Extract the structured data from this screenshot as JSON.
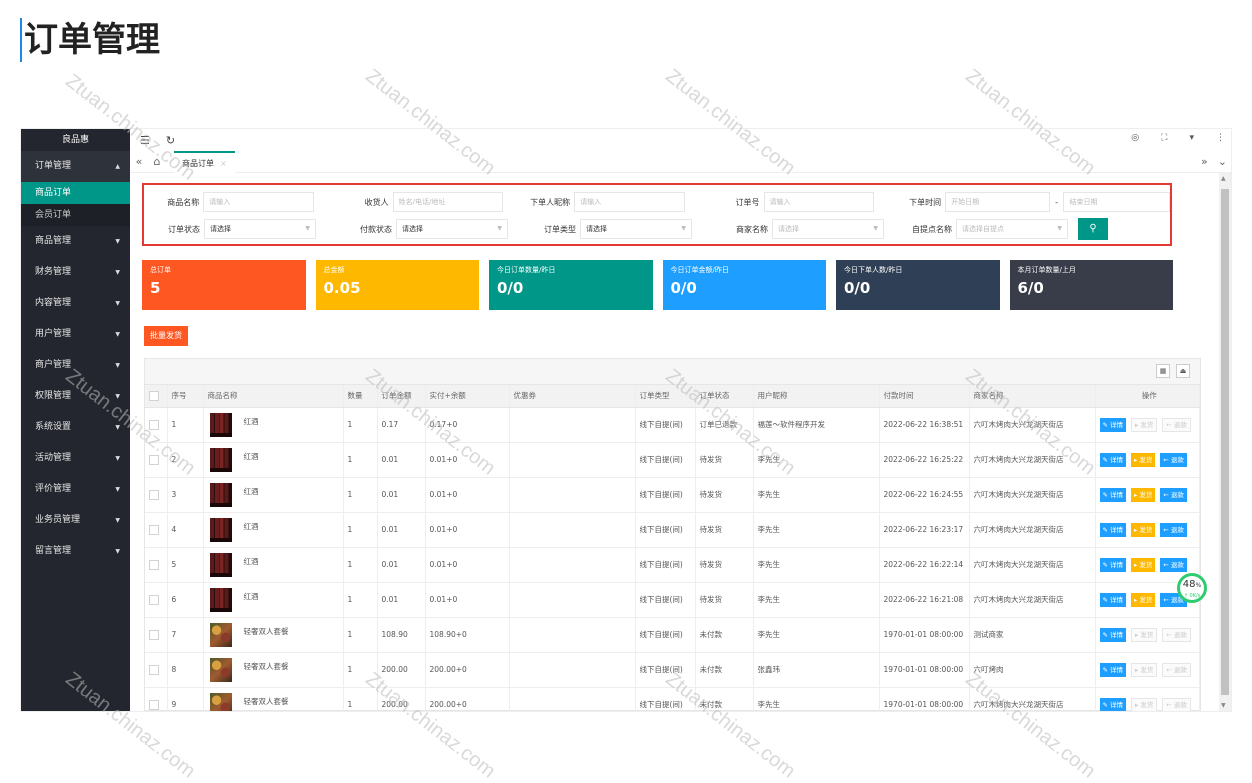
{
  "page_title": "订单管理",
  "watermark": "Ztuan.chinaz.com",
  "sidebar": {
    "logo": "良品惠",
    "menu": [
      {
        "label": "订单管理",
        "open": true,
        "children": [
          {
            "label": "商品订单",
            "active": true
          },
          {
            "label": "会员订单",
            "active": false
          }
        ]
      },
      {
        "label": "商品管理"
      },
      {
        "label": "财务管理"
      },
      {
        "label": "内容管理"
      },
      {
        "label": "用户管理"
      },
      {
        "label": "商户管理"
      },
      {
        "label": "权限管理"
      },
      {
        "label": "系统设置"
      },
      {
        "label": "活动管理"
      },
      {
        "label": "评价管理"
      },
      {
        "label": "业务员管理"
      },
      {
        "label": "留言管理"
      }
    ]
  },
  "tabs": {
    "active_label": "商品订单",
    "close": "×"
  },
  "filters": {
    "product_name": {
      "label": "商品名称",
      "placeholder": "请输入"
    },
    "receiver": {
      "label": "收货人",
      "placeholder": "姓名/电话/地址"
    },
    "buyer_nick": {
      "label": "下单人昵称",
      "placeholder": "请输入"
    },
    "order_no": {
      "label": "订单号",
      "placeholder": "请输入"
    },
    "order_time": {
      "label": "下单时间",
      "start_placeholder": "开始日期",
      "sep": "-",
      "end_placeholder": "结束日期"
    },
    "order_status": {
      "label": "订单状态",
      "value": "请选择"
    },
    "pay_status": {
      "label": "付款状态",
      "value": "请选择"
    },
    "order_type": {
      "label": "订单类型",
      "value": "请选择"
    },
    "merchant": {
      "label": "商家名称",
      "placeholder": "请选择"
    },
    "pickup_point": {
      "label": "自提点名称",
      "placeholder": "请选择自提点"
    },
    "search_icon": "search-icon"
  },
  "cards": [
    {
      "title": "总订单",
      "value": "5",
      "color": "#ff5722"
    },
    {
      "title": "总金额",
      "value": "0.05",
      "color": "#ffb800"
    },
    {
      "title": "今日订单数量/昨日",
      "value": "0/0",
      "color": "#009688"
    },
    {
      "title": "今日订单金额/昨日",
      "value": "0/0",
      "color": "#1e9fff"
    },
    {
      "title": "今日下单人数/昨日",
      "value": "0/0",
      "color": "#2f4056"
    },
    {
      "title": "本月订单数量/上月",
      "value": "6/0",
      "color": "#393d49"
    }
  ],
  "batch_ship": "批量发货",
  "table": {
    "headers": [
      "",
      "序号",
      "商品名称",
      "数量",
      "订单金额",
      "实付+余额",
      "优惠券",
      "订单类型",
      "订单状态",
      "用户昵称",
      "付款时间",
      "商家名称",
      "操作"
    ],
    "op_labels": {
      "detail": "✎ 详情",
      "ship": "▸ 发货",
      "refund": "← 退款"
    },
    "rows": [
      {
        "no": "1",
        "name": "红酒",
        "img": "wine",
        "qty": "1",
        "amount": "0.17",
        "paid": "0.17+0",
        "coupon": "",
        "type": "线下自提(间)",
        "status": "订单已退款",
        "nick": "福莲～软件程序开发",
        "time": "2022-06-22 16:38:51",
        "merchant": "六叮木烤肉大兴龙湖天街店",
        "ship_on": false,
        "refund_on": false
      },
      {
        "no": "2",
        "name": "红酒",
        "img": "wine",
        "qty": "1",
        "amount": "0.01",
        "paid": "0.01+0",
        "coupon": "",
        "type": "线下自提(间)",
        "status": "待发货",
        "nick": "李先生",
        "time": "2022-06-22 16:25:22",
        "merchant": "六叮木烤肉大兴龙湖天街店",
        "ship_on": true,
        "refund_on": true
      },
      {
        "no": "3",
        "name": "红酒",
        "img": "wine",
        "qty": "1",
        "amount": "0.01",
        "paid": "0.01+0",
        "coupon": "",
        "type": "线下自提(间)",
        "status": "待发货",
        "nick": "李先生",
        "time": "2022-06-22 16:24:55",
        "merchant": "六叮木烤肉大兴龙湖天街店",
        "ship_on": true,
        "refund_on": true
      },
      {
        "no": "4",
        "name": "红酒",
        "img": "wine",
        "qty": "1",
        "amount": "0.01",
        "paid": "0.01+0",
        "coupon": "",
        "type": "线下自提(间)",
        "status": "待发货",
        "nick": "李先生",
        "time": "2022-06-22 16:23:17",
        "merchant": "六叮木烤肉大兴龙湖天街店",
        "ship_on": true,
        "refund_on": true
      },
      {
        "no": "5",
        "name": "红酒",
        "img": "wine",
        "qty": "1",
        "amount": "0.01",
        "paid": "0.01+0",
        "coupon": "",
        "type": "线下自提(间)",
        "status": "待发货",
        "nick": "李先生",
        "time": "2022-06-22 16:22:14",
        "merchant": "六叮木烤肉大兴龙湖天街店",
        "ship_on": true,
        "refund_on": true
      },
      {
        "no": "6",
        "name": "红酒",
        "img": "wine",
        "qty": "1",
        "amount": "0.01",
        "paid": "0.01+0",
        "coupon": "",
        "type": "线下自提(间)",
        "status": "待发货",
        "nick": "李先生",
        "time": "2022-06-22 16:21:08",
        "merchant": "六叮木烤肉大兴龙湖天街店",
        "ship_on": true,
        "refund_on": true
      },
      {
        "no": "7",
        "name": "轻奢双人套餐",
        "img": "food",
        "qty": "1",
        "amount": "108.90",
        "paid": "108.90+0",
        "coupon": "",
        "type": "线下自提(间)",
        "status": "未付款",
        "nick": "李先生",
        "time": "1970-01-01 08:00:00",
        "merchant": "测试商家",
        "ship_on": false,
        "refund_on": false
      },
      {
        "no": "8",
        "name": "轻奢双人套餐",
        "img": "food",
        "qty": "1",
        "amount": "200.00",
        "paid": "200.00+0",
        "coupon": "",
        "type": "线下自提(间)",
        "status": "未付款",
        "nick": "张鑫玮",
        "time": "1970-01-01 08:00:00",
        "merchant": "六叮烤肉",
        "ship_on": false,
        "refund_on": false
      },
      {
        "no": "9",
        "name": "轻奢双人套餐",
        "img": "food",
        "qty": "1",
        "amount": "200.00",
        "paid": "200.00+0",
        "coupon": "",
        "type": "线下自提(间)",
        "status": "未付款",
        "nick": "李先生",
        "time": "1970-01-01 08:00:00",
        "merchant": "六叮木烤肉大兴龙湖天街店",
        "ship_on": false,
        "refund_on": false
      }
    ]
  },
  "speed_widget": {
    "percent": "48",
    "unit": "%",
    "rate": "↑ 0K/s"
  }
}
